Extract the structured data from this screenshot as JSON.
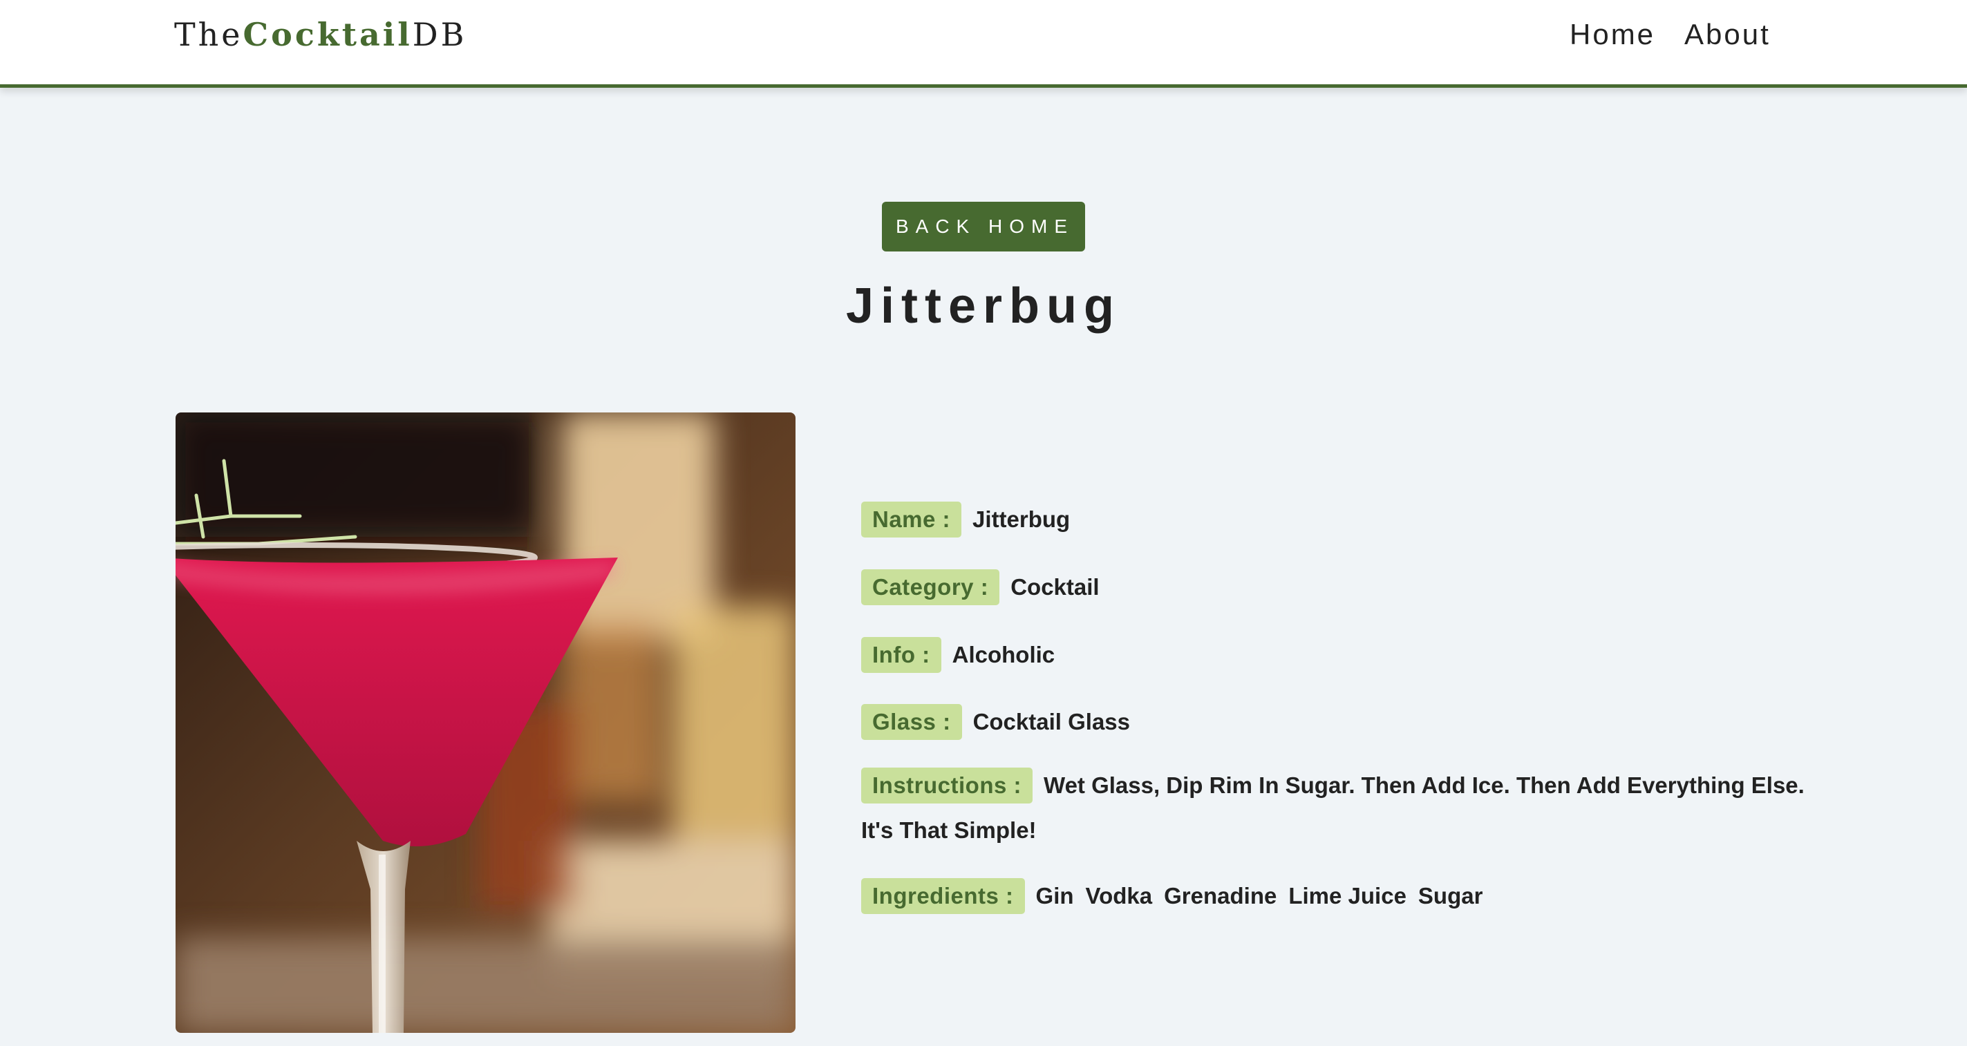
{
  "navbar": {
    "logo": {
      "prefix": "The",
      "accent": "Cocktail",
      "suffix": "DB"
    },
    "links": [
      {
        "label": "Home"
      },
      {
        "label": "About"
      }
    ]
  },
  "back_button": {
    "label": "Back Home"
  },
  "page_title": "Jitterbug",
  "colors": {
    "brand": "#476a30",
    "label_background": "#c9e09b",
    "page_background": "#f0f4f7",
    "drink": "#d0154a"
  },
  "drink": {
    "photo_subject": "red martini cocktail",
    "fields": [
      {
        "label": "Name :",
        "value": "Jitterbug"
      },
      {
        "label": "Category :",
        "value": "Cocktail"
      },
      {
        "label": "Info :",
        "value": "Alcoholic"
      },
      {
        "label": "Glass :",
        "value": "Cocktail Glass"
      },
      {
        "label": "Instructions :",
        "value": "Wet Glass, Dip Rim In Sugar. Then Add Ice. Then Add Everything Else. It's That Simple!"
      }
    ],
    "ingredients_label": "Ingredients :",
    "ingredients": [
      "Gin",
      "Vodka",
      "Grenadine",
      "Lime Juice",
      "Sugar"
    ]
  }
}
